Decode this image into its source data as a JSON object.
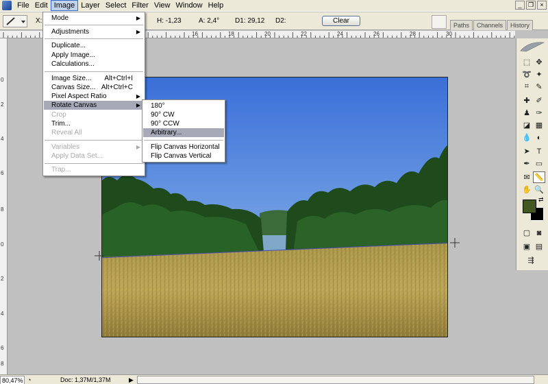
{
  "menubar": {
    "items": [
      "File",
      "Edit",
      "Image",
      "Layer",
      "Select",
      "Filter",
      "View",
      "Window",
      "Help"
    ],
    "active": "Image"
  },
  "options": {
    "x_label": "X:",
    "h_field": "H:  -1,23",
    "a_field": "A:  2,4°",
    "d1_field": "D1:  29,12",
    "d2_field": "D2:",
    "clear_label": "Clear"
  },
  "palette_tabs": [
    "Paths",
    "Channels",
    "History"
  ],
  "ruler_h": [
    "16",
    "18",
    "20",
    "22",
    "24",
    "26",
    "28",
    "30"
  ],
  "ruler_v": [
    "0",
    "2",
    "4",
    "6",
    "8",
    "0",
    "2",
    "4",
    "6",
    "8"
  ],
  "image_menu": {
    "mode": "Mode",
    "adjustments": "Adjustments",
    "duplicate": "Duplicate...",
    "apply_image": "Apply Image...",
    "calculations": "Calculations...",
    "image_size": "Image Size...",
    "image_size_sc": "Alt+Ctrl+I",
    "canvas_size": "Canvas Size...",
    "canvas_size_sc": "Alt+Ctrl+C",
    "pixel_aspect": "Pixel Aspect Ratio",
    "rotate_canvas": "Rotate Canvas",
    "crop": "Crop",
    "trim": "Trim...",
    "reveal_all": "Reveal All",
    "variables": "Variables",
    "apply_data_set": "Apply Data Set...",
    "trap": "Trap..."
  },
  "rotate_menu": {
    "r180": "180°",
    "r90cw": "90° CW",
    "r90ccw": "90° CCW",
    "arbitrary": "Arbitrary...",
    "flip_h": "Flip Canvas Horizontal",
    "flip_v": "Flip Canvas Vertical"
  },
  "colors": {
    "foreground": "#435820",
    "background": "#000000",
    "menu_highlight": "#a7a9b9"
  },
  "status": {
    "zoom": "80,47%",
    "doc": "Doc: 1,37M/1,37M"
  }
}
